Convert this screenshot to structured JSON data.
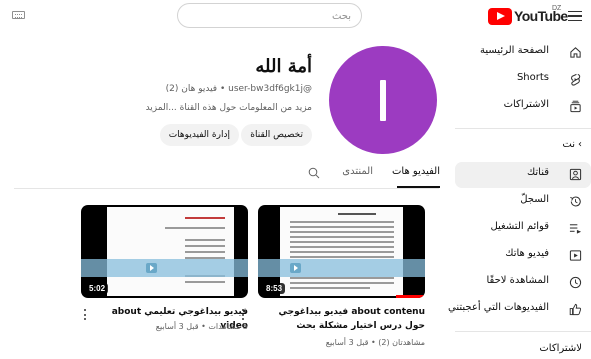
{
  "topbar": {
    "search_placeholder": "بحث",
    "logo_text": "YouTube",
    "logo_country": "DZ"
  },
  "sidebar": {
    "main_items": [
      {
        "label": "الصفحة الرئيسية",
        "icon": "home-icon"
      },
      {
        "label": "Shorts",
        "icon": "shorts-icon"
      },
      {
        "label": "الاشتراكات",
        "icon": "subscriptions-icon"
      }
    ],
    "you_heading": "نت",
    "you_items": [
      {
        "label": "قناتك",
        "icon": "your-channel-icon",
        "active": true
      },
      {
        "label": "السجلّ",
        "icon": "history-icon"
      },
      {
        "label": "قوائم التشغيل",
        "icon": "playlists-icon"
      },
      {
        "label": "فيديو هاتك",
        "icon": "your-videos-icon"
      },
      {
        "label": "المشاهدة لاحقًا",
        "icon": "watch-later-icon"
      },
      {
        "label": "الفيديوهات التي أعجبتني",
        "icon": "liked-videos-icon"
      }
    ],
    "subscriptions_heading": "لاشتراكات"
  },
  "channel": {
    "name": "أمة الله",
    "handle": "@user-bw3df6gk1j",
    "video_count": "فيديو هان (2)",
    "meta_separator": " • ",
    "description": "مزيد من المعلومات حول هذه القناة ...المزيد",
    "customize_button": "تخصيص القناة",
    "manage_button": "إدارة الفيديوهات",
    "avatar_color": "#9c3bc1"
  },
  "tabs": {
    "items": [
      {
        "label": "الفيديو هات",
        "active": true
      },
      {
        "label": "المنتدى",
        "active": false
      }
    ]
  },
  "videos": [
    {
      "title": "about contenu فيديو بيداغوجي حول درس اختيار مشكلة بحث",
      "duration": "8:53",
      "meta": "مشاهدتان (2) • قبل 3 أسابيع",
      "progress": 0.15
    },
    {
      "title": "فيديو بيداغوجي تعليمي about video",
      "duration": "5:02",
      "meta": "5 مشاهدات • قبل 3 أسابيع",
      "progress": 0
    }
  ]
}
